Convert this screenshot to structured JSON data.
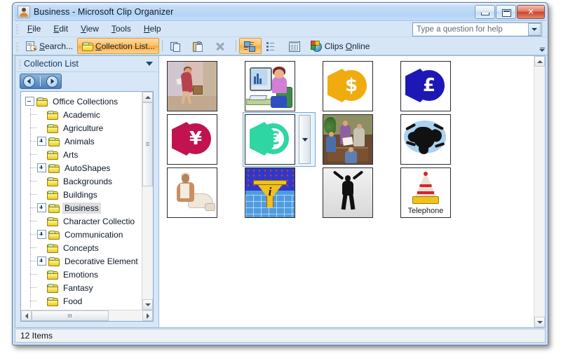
{
  "window": {
    "title": "Business - Microsoft Clip Organizer",
    "icon": "clip-organizer-icon",
    "controls": {
      "minimize": "Minimize",
      "maximize": "Maximize",
      "close": "✕"
    }
  },
  "menubar": {
    "items": [
      {
        "label": "File",
        "accel": "F"
      },
      {
        "label": "Edit",
        "accel": "E"
      },
      {
        "label": "View",
        "accel": "V"
      },
      {
        "label": "Tools",
        "accel": "T"
      },
      {
        "label": "Help",
        "accel": "H"
      }
    ],
    "help_box": {
      "placeholder": "Type a question for help",
      "value": ""
    }
  },
  "toolbar": {
    "buttons": [
      {
        "label": "Search...",
        "accel": "S",
        "icon": "search-icon",
        "active": false
      },
      {
        "label": "Collection List...",
        "accel": "C",
        "icon": "folder-icon",
        "active": true
      }
    ],
    "icon_buttons": [
      {
        "name": "copy-button",
        "icon": "copy-icon",
        "active": false
      },
      {
        "name": "paste-button",
        "icon": "paste-icon",
        "active": false
      },
      {
        "name": "delete-button",
        "icon": "delete-x-icon",
        "active": false
      },
      {
        "name": "thumbnail-view-button",
        "icon": "thumbnail-view-icon",
        "active": true
      },
      {
        "name": "list-view-button",
        "icon": "list-view-icon",
        "active": false
      },
      {
        "name": "details-view-button",
        "icon": "details-table-icon",
        "active": false
      }
    ],
    "clips_online": {
      "label": "Clips Online",
      "accel": "O",
      "icon": "globe-icon"
    },
    "overflow": "toolbar-options-icon"
  },
  "taskpane": {
    "title": "Collection List",
    "caret": "chevron-down-icon",
    "nav": {
      "back": "back-arrow-icon",
      "forward": "forward-arrow-icon"
    },
    "tree": [
      {
        "label": "Office Collections",
        "level": 0,
        "expander": "minus",
        "selected": false
      },
      {
        "label": "Academic",
        "level": 1,
        "expander": "none",
        "selected": false
      },
      {
        "label": "Agriculture",
        "level": 1,
        "expander": "none",
        "selected": false
      },
      {
        "label": "Animals",
        "level": 1,
        "expander": "plus",
        "selected": false
      },
      {
        "label": "Arts",
        "level": 1,
        "expander": "none",
        "selected": false
      },
      {
        "label": "AutoShapes",
        "level": 1,
        "expander": "plus",
        "selected": false
      },
      {
        "label": "Backgrounds",
        "level": 1,
        "expander": "none",
        "selected": false
      },
      {
        "label": "Buildings",
        "level": 1,
        "expander": "none",
        "selected": false
      },
      {
        "label": "Business",
        "level": 1,
        "expander": "plus",
        "selected": true
      },
      {
        "label": "Character Collectio",
        "level": 1,
        "expander": "none",
        "selected": false
      },
      {
        "label": "Communication",
        "level": 1,
        "expander": "plus",
        "selected": false
      },
      {
        "label": "Concepts",
        "level": 1,
        "expander": "none",
        "selected": false
      },
      {
        "label": "Decorative Element",
        "level": 1,
        "expander": "plus",
        "selected": false
      },
      {
        "label": "Emotions",
        "level": 1,
        "expander": "none",
        "selected": false
      },
      {
        "label": "Fantasy",
        "level": 1,
        "expander": "none",
        "selected": false
      },
      {
        "label": "Food",
        "level": 1,
        "expander": "none",
        "selected": false
      }
    ]
  },
  "clips": {
    "items": [
      {
        "name": "clip-businesswoman-walking",
        "art": "walk",
        "caption": "",
        "selected": false
      },
      {
        "name": "clip-woman-at-computer",
        "art": "pc",
        "caption": "",
        "selected": false
      },
      {
        "name": "clip-dollar-coin",
        "art": "coin",
        "symbol": "$",
        "color": "#f0ac0e",
        "filled": true,
        "caption": "",
        "selected": false
      },
      {
        "name": "clip-pound-coin",
        "art": "coin",
        "symbol": "£",
        "color": "#1d18b5",
        "filled": true,
        "caption": "",
        "selected": false
      },
      {
        "name": "clip-yen-coin",
        "art": "coin",
        "symbol": "¥",
        "color": "#c2124f",
        "filled": true,
        "caption": "",
        "selected": false
      },
      {
        "name": "clip-euro-coin",
        "art": "coin",
        "symbol": "€",
        "color": "#2ed6a4",
        "filled": false,
        "caption": "",
        "selected": true
      },
      {
        "name": "clip-business-meeting",
        "art": "meet",
        "caption": "",
        "selected": false
      },
      {
        "name": "clip-multitasking-chaos",
        "art": "chaos",
        "caption": "",
        "selected": false
      },
      {
        "name": "clip-man-sitting",
        "art": "sit",
        "caption": "",
        "selected": false
      },
      {
        "name": "clip-information-funnel",
        "art": "funnel",
        "caption": "",
        "selected": false
      },
      {
        "name": "clip-celebrating-silhouette",
        "art": "cheer",
        "caption": "",
        "selected": false
      },
      {
        "name": "clip-telephone",
        "art": "cone",
        "caption": "Telephone",
        "selected": false
      }
    ],
    "selected_dropdown": "clip-options-dropdown-icon"
  },
  "statusbar": {
    "text": "12 Items"
  }
}
